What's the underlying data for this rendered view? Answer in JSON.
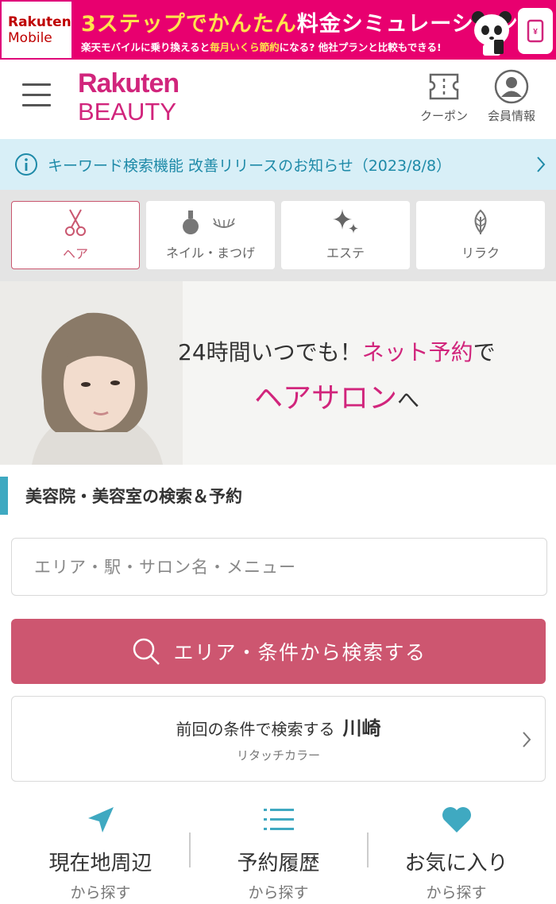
{
  "banner": {
    "logo_line1": "Rakuten",
    "logo_line2": "Mobile",
    "title_a": "3ステップで",
    "title_b": "かんたん",
    "title_c": "料金シミュレーション",
    "sub_a": "楽天モバイルに乗り換えると",
    "sub_b": "毎月いくら節約",
    "sub_c": "になる? 他社プランと比較もできる!"
  },
  "header": {
    "logo_rakuten": "Rakuten",
    "logo_beauty": "BEAUTY",
    "coupon_label": "クーポン",
    "member_label": "会員情報"
  },
  "notice": {
    "text": "キーワード検索機能 改善リリースのお知らせ（2023/8/8）"
  },
  "categories": [
    {
      "label": "ヘア",
      "icon": "scissors-icon",
      "active": true
    },
    {
      "label": "ネイル・まつげ",
      "icon": "nail-lash-icon",
      "active": false
    },
    {
      "label": "エステ",
      "icon": "sparkle-icon",
      "active": false
    },
    {
      "label": "リラク",
      "icon": "leaf-icon",
      "active": false
    }
  ],
  "hero": {
    "line1_a": "24時間いつでも！",
    "line1_b": "ネット予約",
    "line1_c": "で",
    "line2_a": "ヘアサロン",
    "line2_b": "へ"
  },
  "search": {
    "section_title": "美容院・美容室の検索＆予約",
    "placeholder": "エリア・駅・サロン名・メニュー",
    "button_label": "エリア・条件から検索する",
    "prev_label": "前回の条件で検索する",
    "prev_location": "川崎",
    "prev_condition": "リタッチカラー"
  },
  "quick_links": [
    {
      "title": "現在地周辺",
      "sub": "から探す",
      "icon": "location-arrow-icon"
    },
    {
      "title": "予約履歴",
      "sub": "から探す",
      "icon": "list-icon"
    },
    {
      "title": "お気に入り",
      "sub": "から探す",
      "icon": "heart-icon"
    }
  ],
  "colors": {
    "brand_pink": "#d1257c",
    "banner_pink": "#e8006f",
    "button_rose": "#cd5670",
    "teal": "#3fa9c1",
    "notice_bg": "#d8eff7"
  }
}
